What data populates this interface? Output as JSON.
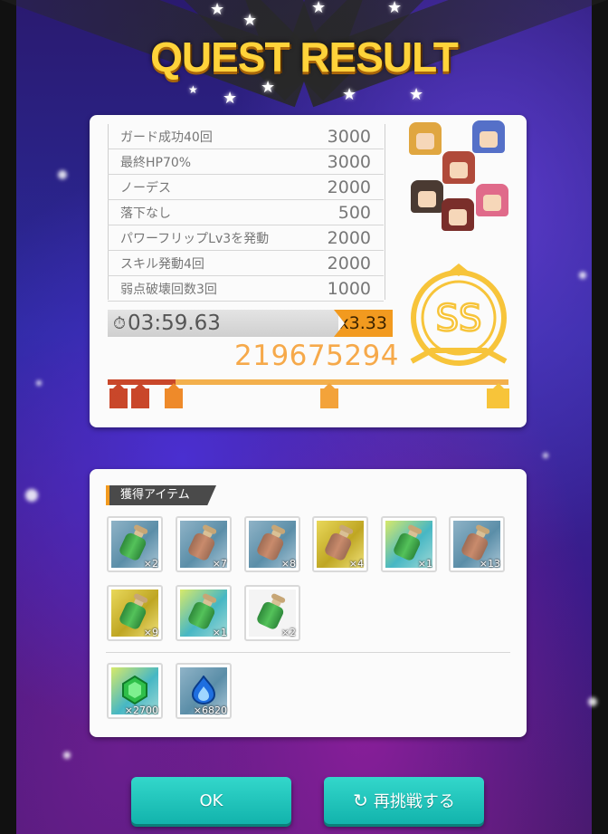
{
  "title": "QUEST RESULT",
  "bonuses": [
    {
      "label": "ガード成功40回",
      "points": "3000"
    },
    {
      "label": "最終HP70%",
      "points": "3000"
    },
    {
      "label": "ノーデス",
      "points": "2000"
    },
    {
      "label": "落下なし",
      "points": "500"
    },
    {
      "label": "パワーフリップLv3を発動",
      "points": "2000"
    },
    {
      "label": "スキル発動4回",
      "points": "2000"
    },
    {
      "label": "弱点破壊回数3回",
      "points": "1000"
    }
  ],
  "clear_time": "03:59.63",
  "multiplier": "x3.33",
  "score": "219675294",
  "rank": "SS",
  "rank_marks": [
    "C",
    "B",
    "A",
    "S",
    "SS"
  ],
  "rank_progress": 1.0,
  "items_header": "獲得アイテム",
  "items": [
    {
      "icon": "green-potion-icon",
      "count": "×2",
      "frame": "blue"
    },
    {
      "icon": "tan-potion-icon",
      "count": "×7",
      "frame": "blue"
    },
    {
      "icon": "tan-potion-icon",
      "count": "×8",
      "frame": "blue"
    },
    {
      "icon": "tan-potion-icon",
      "count": "×4",
      "frame": "gold"
    },
    {
      "icon": "green-potion-icon",
      "count": "×1",
      "frame": "teal"
    },
    {
      "icon": "tan-potion-icon",
      "count": "×13",
      "frame": "blue"
    },
    {
      "icon": "green-potion-icon",
      "count": "×9",
      "frame": "gold"
    },
    {
      "icon": "green-potion-icon",
      "count": "×1",
      "frame": "teal"
    },
    {
      "icon": "green-potion-icon",
      "count": "×2",
      "frame": "plain"
    }
  ],
  "currencies": [
    {
      "icon": "green-gem-icon",
      "count": "×2700",
      "frame": "teal"
    },
    {
      "icon": "blue-flame-icon",
      "count": "×6820",
      "frame": "blue"
    }
  ],
  "buttons": {
    "ok": "OK",
    "retry": "再挑戦する"
  },
  "colors": {
    "accent_orange": "#f29a1f",
    "button_teal": "#1fc4bc",
    "rank_gold": "#f7c43a"
  }
}
